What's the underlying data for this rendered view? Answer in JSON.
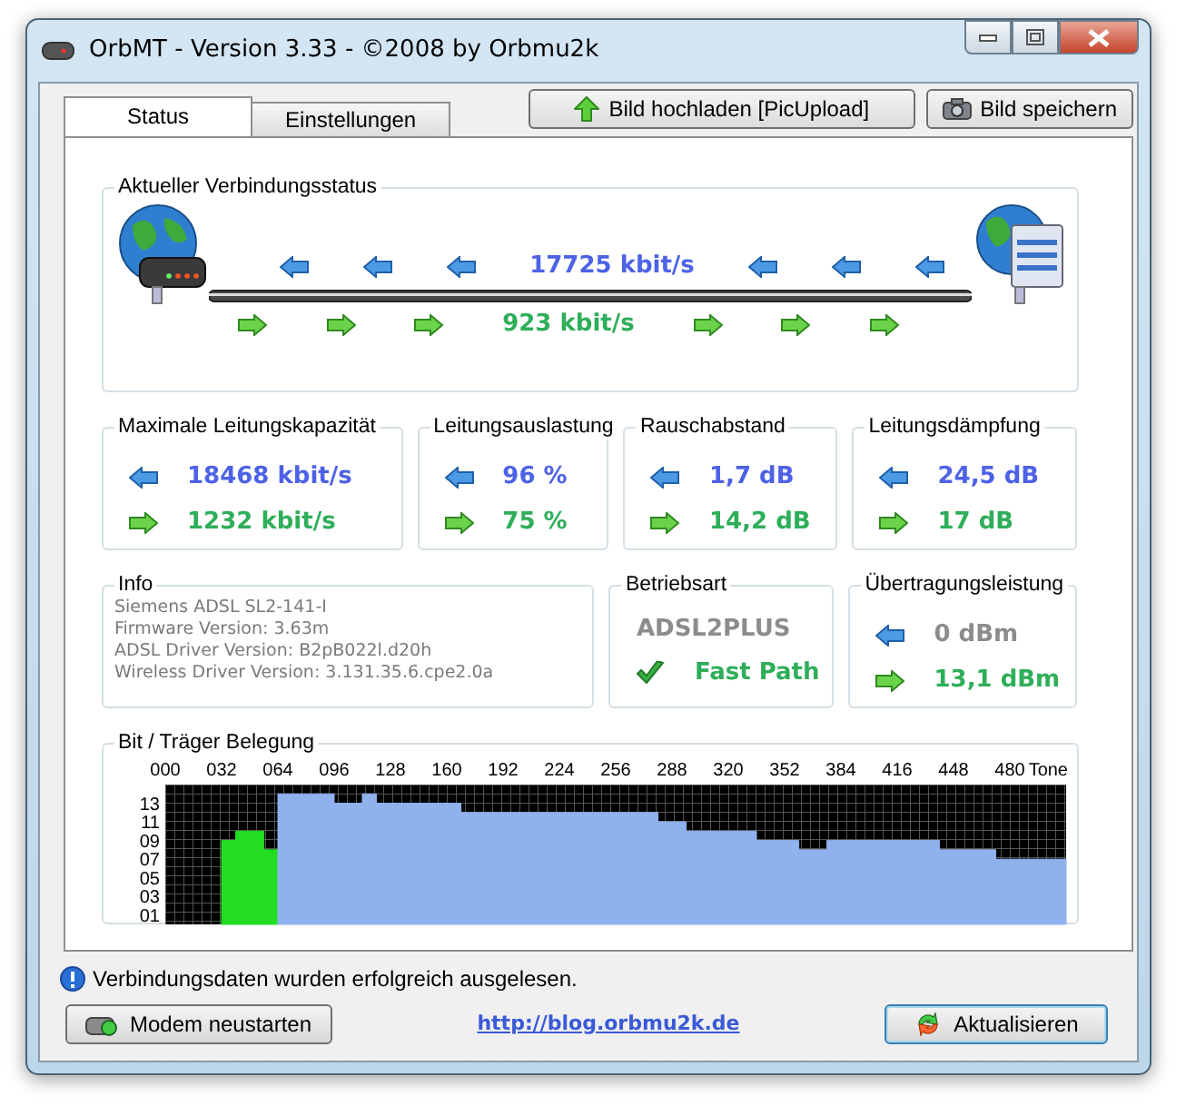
{
  "window": {
    "title": "OrbMT - Version 3.33 - ©2008 by Orbmu2k"
  },
  "tabs": [
    {
      "label": "Status",
      "selected": true
    },
    {
      "label": "Einstellungen",
      "selected": false
    }
  ],
  "toolbar_buttons": [
    {
      "label": "Bild hochladen [PicUpload]",
      "kind": "upload"
    },
    {
      "label": "Bild speichern",
      "kind": "camera"
    }
  ],
  "connection_status": {
    "title": "Aktueller Verbindungsstatus",
    "downstream": "17725 kbit/s",
    "upstream": "923 kbit/s"
  },
  "stats": [
    {
      "title": "Maximale Leitungskapazität",
      "down": "18468 kbit/s",
      "up": "1232 kbit/s"
    },
    {
      "title": "Leitungsauslastung",
      "down": "96 %",
      "up": "75 %"
    },
    {
      "title": "Rauschabstand",
      "down": "1,7 dB",
      "up": "14,2 dB"
    },
    {
      "title": "Leitungsdämpfung",
      "down": "24,5 dB",
      "up": "17 dB"
    }
  ],
  "info": {
    "title": "Info",
    "lines": [
      "Siemens ADSL SL2-141-I",
      "Firmware Version: 3.63m",
      "ADSL Driver Version: B2pB022l.d20h",
      "Wireless Driver Version: 3.131.35.6.cpe2.0a"
    ]
  },
  "mode": {
    "title": "Betriebsart",
    "value": "ADSL2PLUS",
    "fast_path": "Fast Path",
    "fast_path_on": true
  },
  "power": {
    "title": "Übertragungsleistung",
    "down": "0 dBm",
    "down_disabled": true,
    "up": "13,1 dBm",
    "up_disabled": false
  },
  "bit_loading": {
    "title": "Bit / Träger Belegung",
    "chart_data": {
      "type": "area",
      "xlabel": "Tone",
      "x": [
        32,
        40,
        40,
        56,
        56,
        64,
        64,
        96,
        96,
        112,
        112,
        120,
        120,
        168,
        168,
        280,
        280,
        296,
        296,
        336,
        336,
        360,
        360,
        376,
        376,
        440,
        440,
        472,
        472,
        512
      ],
      "series": [
        {
          "color": "#22dd22",
          "values": [
            9,
            9,
            10,
            10,
            8,
            8,
            null,
            null,
            null,
            null,
            null,
            null,
            null,
            null,
            null,
            null,
            null,
            null,
            null,
            null,
            null,
            null,
            null,
            null,
            null,
            null,
            null,
            null,
            null,
            null
          ]
        },
        {
          "color": "#8fb2ee",
          "values": [
            null,
            null,
            null,
            null,
            null,
            null,
            14,
            14,
            13,
            13,
            14,
            14,
            13,
            13,
            12,
            12,
            11,
            11,
            10,
            10,
            9,
            9,
            8,
            8,
            9,
            9,
            8,
            8,
            7,
            7
          ]
        }
      ],
      "xlim": [
        0,
        512
      ],
      "ylim": [
        0,
        15
      ],
      "xticks": [
        {
          "value": 0,
          "label": "000"
        },
        {
          "value": 32,
          "label": "032"
        },
        {
          "value": 64,
          "label": "064"
        },
        {
          "value": 96,
          "label": "096"
        },
        {
          "value": 128,
          "label": "128"
        },
        {
          "value": 160,
          "label": "160"
        },
        {
          "value": 192,
          "label": "192"
        },
        {
          "value": 224,
          "label": "224"
        },
        {
          "value": 256,
          "label": "256"
        },
        {
          "value": 288,
          "label": "288"
        },
        {
          "value": 320,
          "label": "320"
        },
        {
          "value": 352,
          "label": "352"
        },
        {
          "value": 384,
          "label": "384"
        },
        {
          "value": 416,
          "label": "416"
        },
        {
          "value": 448,
          "label": "448"
        },
        {
          "value": 480,
          "label": "480"
        }
      ],
      "yticks": [
        {
          "value": 1,
          "label": "01"
        },
        {
          "value": 3,
          "label": "03"
        },
        {
          "value": 5,
          "label": "05"
        },
        {
          "value": 7,
          "label": "07"
        },
        {
          "value": 9,
          "label": "09"
        },
        {
          "value": 11,
          "label": "11"
        },
        {
          "value": 13,
          "label": "13"
        }
      ]
    }
  },
  "status_bar": {
    "message": "Verbindungsdaten wurden erfolgreich ausgelesen."
  },
  "footer": {
    "restart_button": "Modem neustarten",
    "link": "http://blog.orbmu2k.de",
    "refresh_button": "Aktualisieren"
  }
}
